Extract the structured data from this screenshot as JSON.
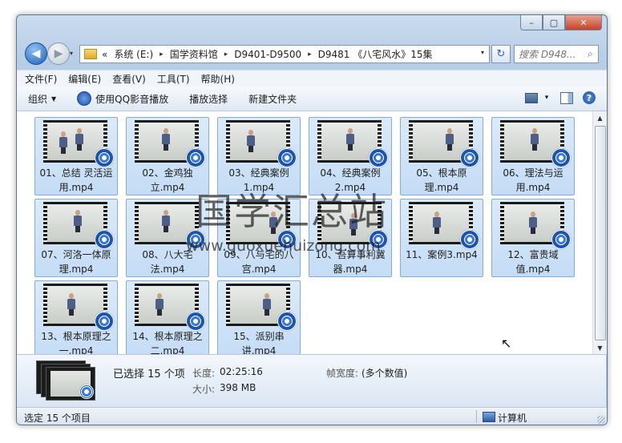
{
  "window": {
    "min": "–",
    "max": "▢",
    "close": "✕"
  },
  "nav": {
    "back": "◀",
    "forward": "▶",
    "history": "▾"
  },
  "address": {
    "prefix": "«",
    "crumbs": [
      "系统 (E:)",
      "国学资料馆",
      "D9401-D9500",
      "D9481 《八宅风水》15集"
    ],
    "separator": "▸",
    "dropdown": "▾"
  },
  "refresh": "↻",
  "search": {
    "placeholder": "搜索 D948...",
    "icon": "search-icon"
  },
  "menu": [
    "文件(F)",
    "编辑(E)",
    "查看(V)",
    "工具(T)",
    "帮助(H)"
  ],
  "toolbar": {
    "organize": "组织",
    "qq_play": "使用QQ影音播放",
    "slideshow": "播放选择",
    "new_folder": "新建文件夹",
    "view_caret": "▾",
    "help": "?"
  },
  "files": [
    {
      "name": "01、总结 灵活运用.mp4"
    },
    {
      "name": "02、金鸡独立.mp4"
    },
    {
      "name": "03、经典案例1.mp4"
    },
    {
      "name": "04、经典案例2.mp4"
    },
    {
      "name": "05、根本原理.mp4"
    },
    {
      "name": "06、理法与运用.mp4"
    },
    {
      "name": "07、河洛一体原理.mp4"
    },
    {
      "name": "08、八大宅法.mp4"
    },
    {
      "name": "09、八与宅的八宫.mp4"
    },
    {
      "name": "10、吾算事利冀器.mp4"
    },
    {
      "name": "11、案例3.mp4"
    },
    {
      "name": "12、富贵域值.mp4"
    },
    {
      "name": "13、根本原理之一.mp4"
    },
    {
      "name": "14、根本原理之二.mp4"
    },
    {
      "name": "15、派别串讲.mp4"
    }
  ],
  "watermark": {
    "text": "国学汇总站",
    "url": "www.guoxuehuizong.com"
  },
  "details": {
    "selected": "已选择 15 个项",
    "length_label": "长度:",
    "length_value": "02:25:16",
    "size_label": "大小:",
    "size_value": "398 MB",
    "fps_label": "帧宽度:",
    "fps_value": "(多个数值)"
  },
  "statusbar": {
    "left": "选定 15 个项目",
    "right": "计算机"
  },
  "scroll": {
    "up": "▲",
    "down": "▼"
  },
  "colors": {
    "accent": "#3a78d1",
    "selection": "#c4dcf5",
    "frame": "#b7cde6"
  }
}
